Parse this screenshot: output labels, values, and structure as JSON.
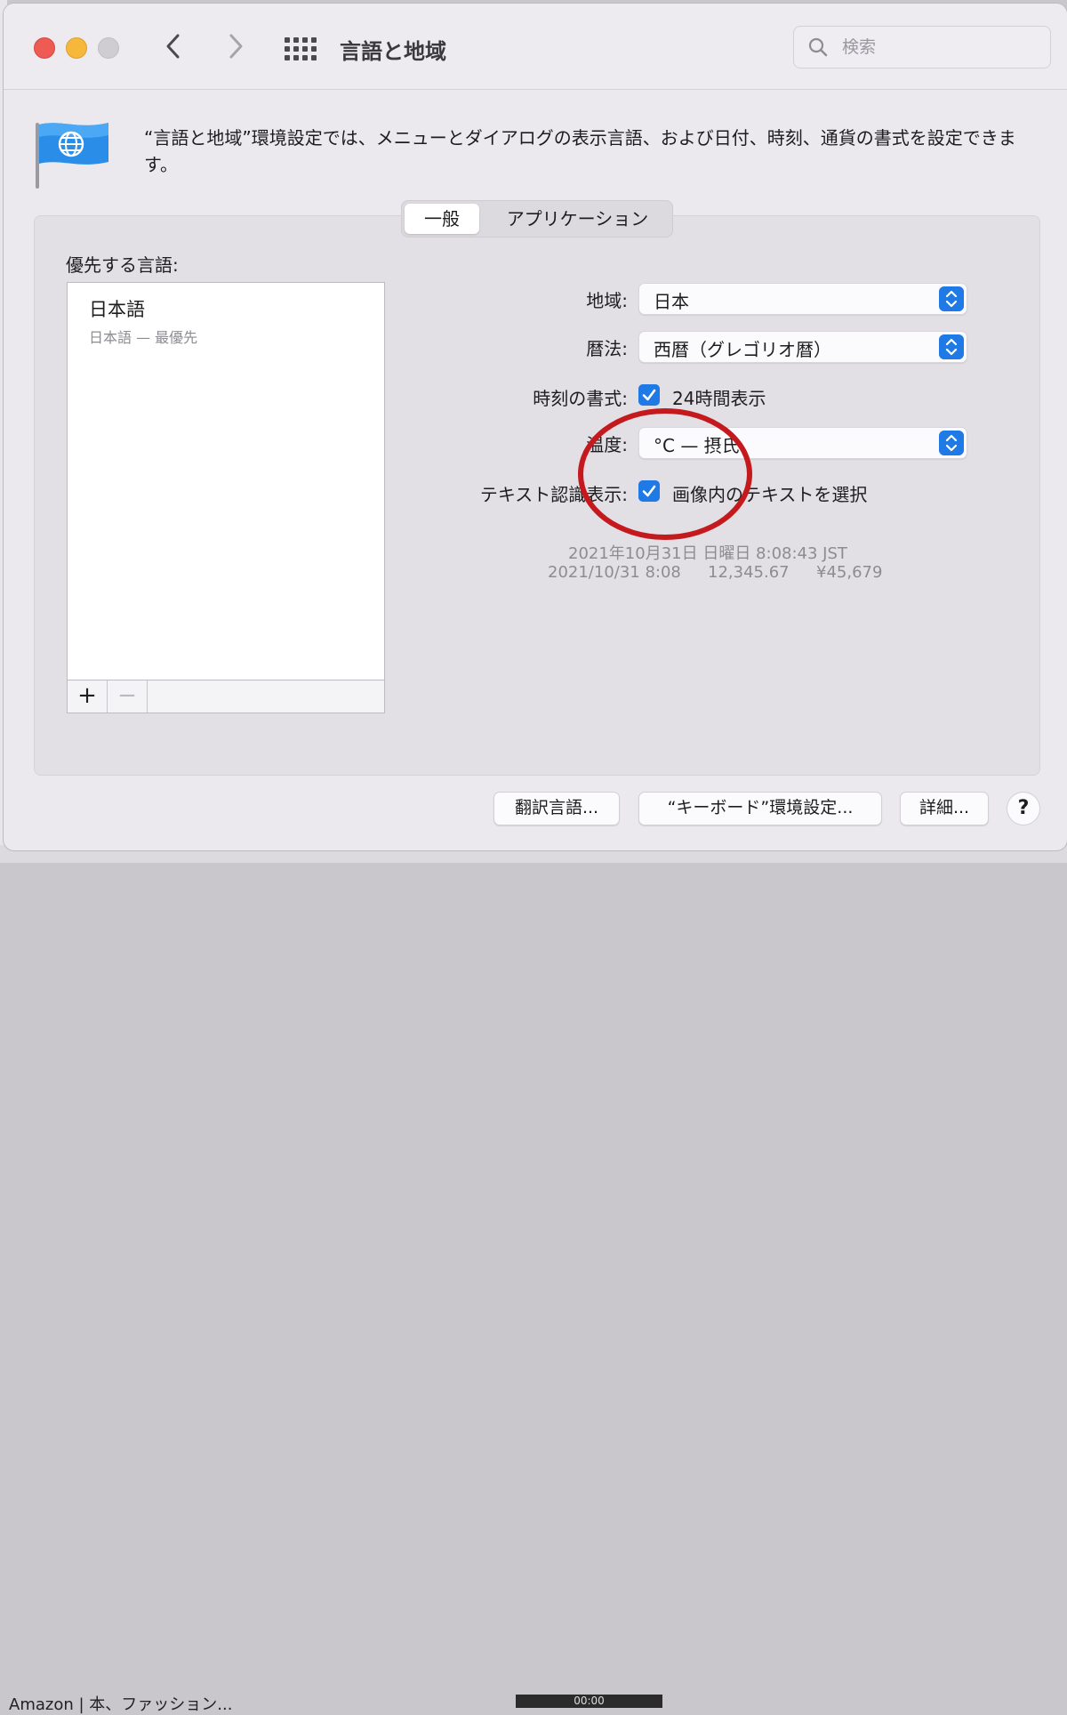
{
  "window": {
    "title": "言語と地域",
    "search_placeholder": "検索"
  },
  "description": "“言語と地域”環境設定では、メニューとダイアログの表示言語、および日付、時刻、通貨の書式を設定できます。",
  "tabs": [
    {
      "label": "一般",
      "selected": true
    },
    {
      "label": "アプリケーション",
      "selected": false
    }
  ],
  "languages": {
    "title": "優先する言語:",
    "items": [
      {
        "name": "日本語",
        "subtitle": "日本語 — 最優先"
      }
    ],
    "add_label": "+",
    "remove_label": "−"
  },
  "settings": {
    "region": {
      "label": "地域:",
      "value": "日本"
    },
    "calendar": {
      "label": "暦法:",
      "value": "西暦（グレゴリオ暦）"
    },
    "time_format": {
      "label": "時刻の書式:",
      "checkbox_label": "24時間表示",
      "checked": true
    },
    "temperature": {
      "label": "温度:",
      "value": "°C — 摂氏"
    },
    "live_text": {
      "label": "テキスト認識表示:",
      "checkbox_label": "画像内のテキストを選択",
      "checked": true
    }
  },
  "sample": {
    "line1": "2021年10月31日 日曜日 8:08:43 JST",
    "date_short": "2021/10/31 8:08",
    "number": "12,345.67",
    "currency": "¥45,679"
  },
  "buttons": {
    "translation": "翻訳言語...",
    "keyboard": "“キーボード”環境設定...",
    "advanced": "詳細...",
    "help": "?"
  },
  "colors": {
    "accent": "#1f7ae6",
    "annotation_ring": "#c41a1d"
  },
  "background": {
    "bottom_text": "Amazon | 本、ファッション...",
    "bottom_clock": "00:00"
  }
}
